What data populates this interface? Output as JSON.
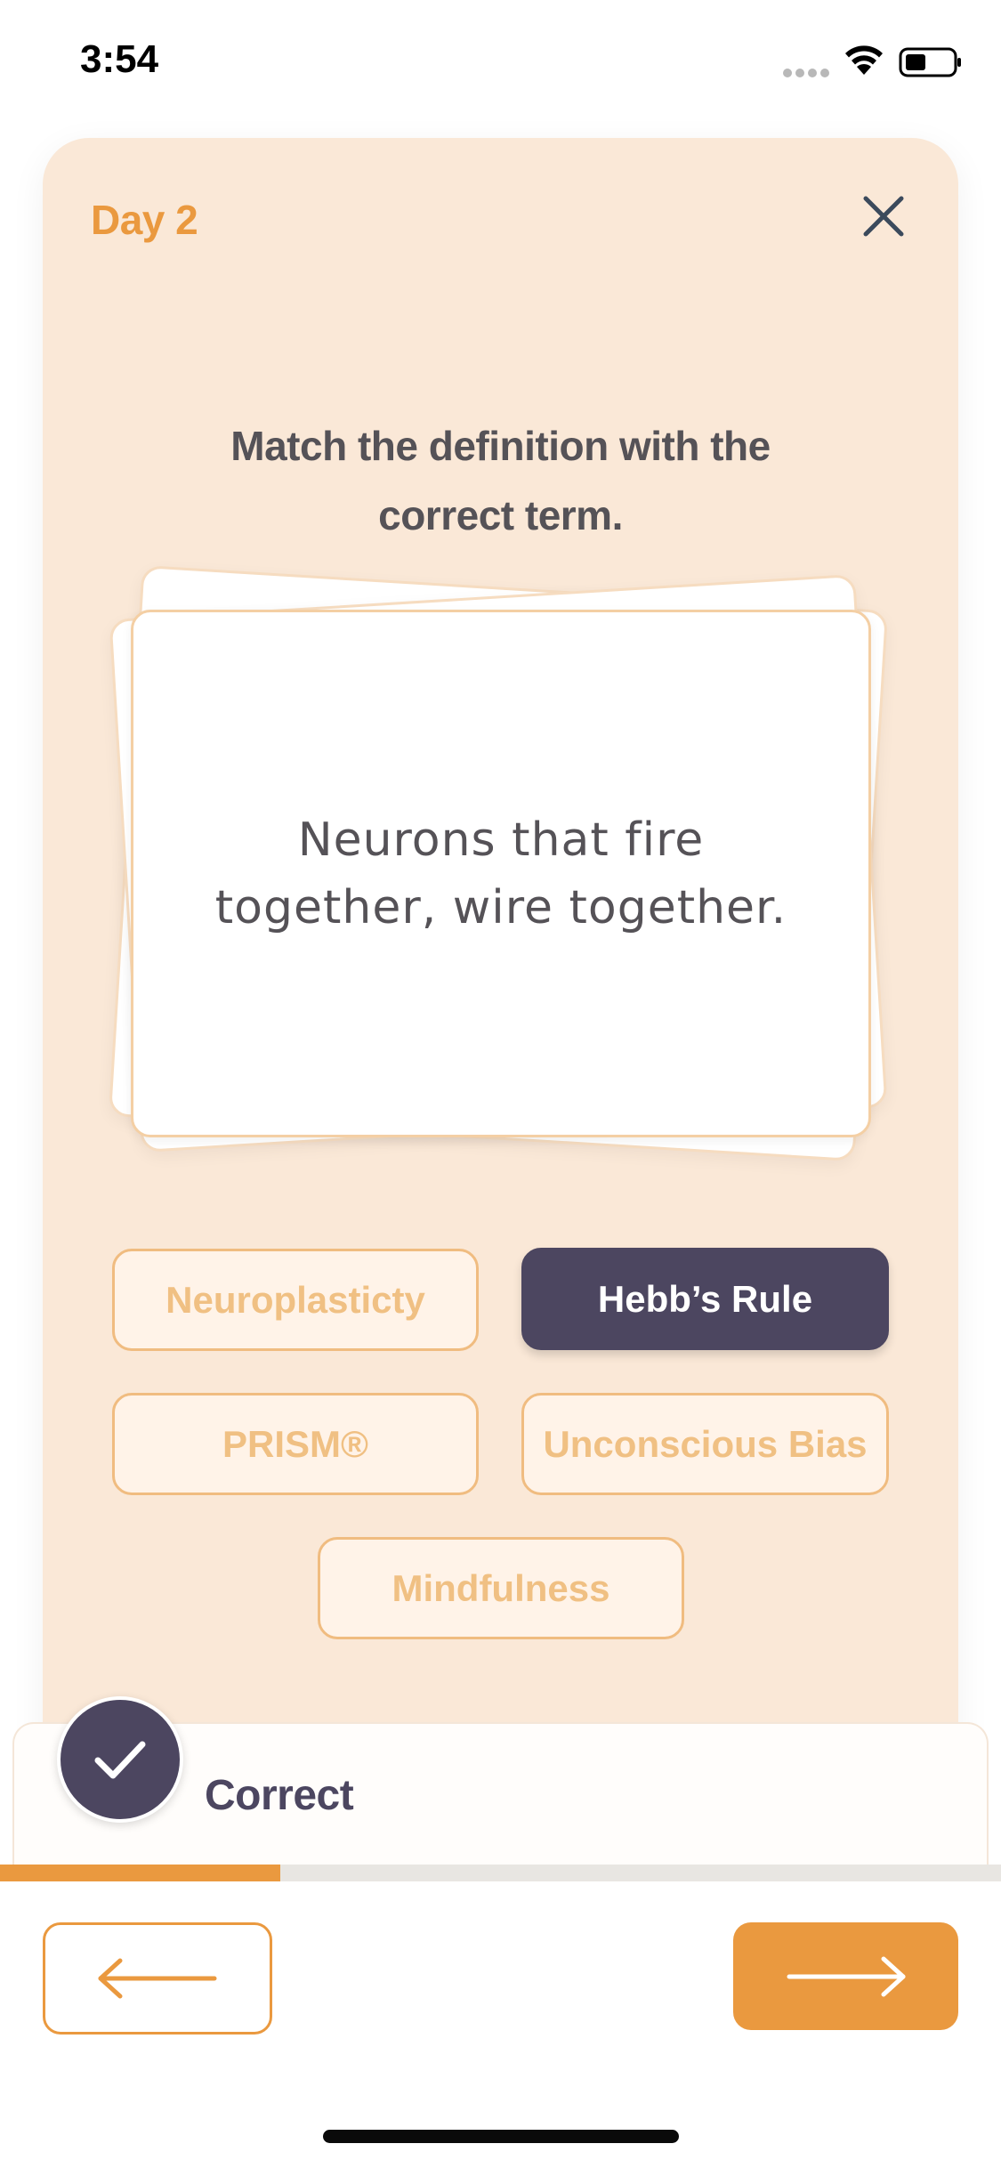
{
  "status_bar": {
    "time": "3:54",
    "icons": [
      "cellular-signal-icon",
      "wifi-icon",
      "battery-icon"
    ]
  },
  "header": {
    "day_label": "Day 2",
    "close_icon": "close-icon"
  },
  "quiz": {
    "instruction": "Match the definition with the correct term.",
    "definition": "Neurons that fire together, wire together.",
    "options": [
      {
        "label": "Neuroplasticty",
        "selected": false
      },
      {
        "label": "Hebb’s Rule",
        "selected": true
      },
      {
        "label": "PRISM®",
        "selected": false
      },
      {
        "label": "Unconscious Bias",
        "selected": false
      },
      {
        "label": "Mindfulness",
        "selected": false
      }
    ]
  },
  "feedback": {
    "status": "Correct",
    "icon": "checkmark-icon"
  },
  "progress": {
    "fraction": 0.28
  },
  "navigation": {
    "back_icon": "arrow-left-icon",
    "next_icon": "arrow-right-icon"
  },
  "colors": {
    "accent": "#ea993f",
    "panel_bg": "#fae8d7",
    "selected_bg": "#4c4660",
    "option_text": "#f0c083",
    "body_text": "#555257"
  }
}
